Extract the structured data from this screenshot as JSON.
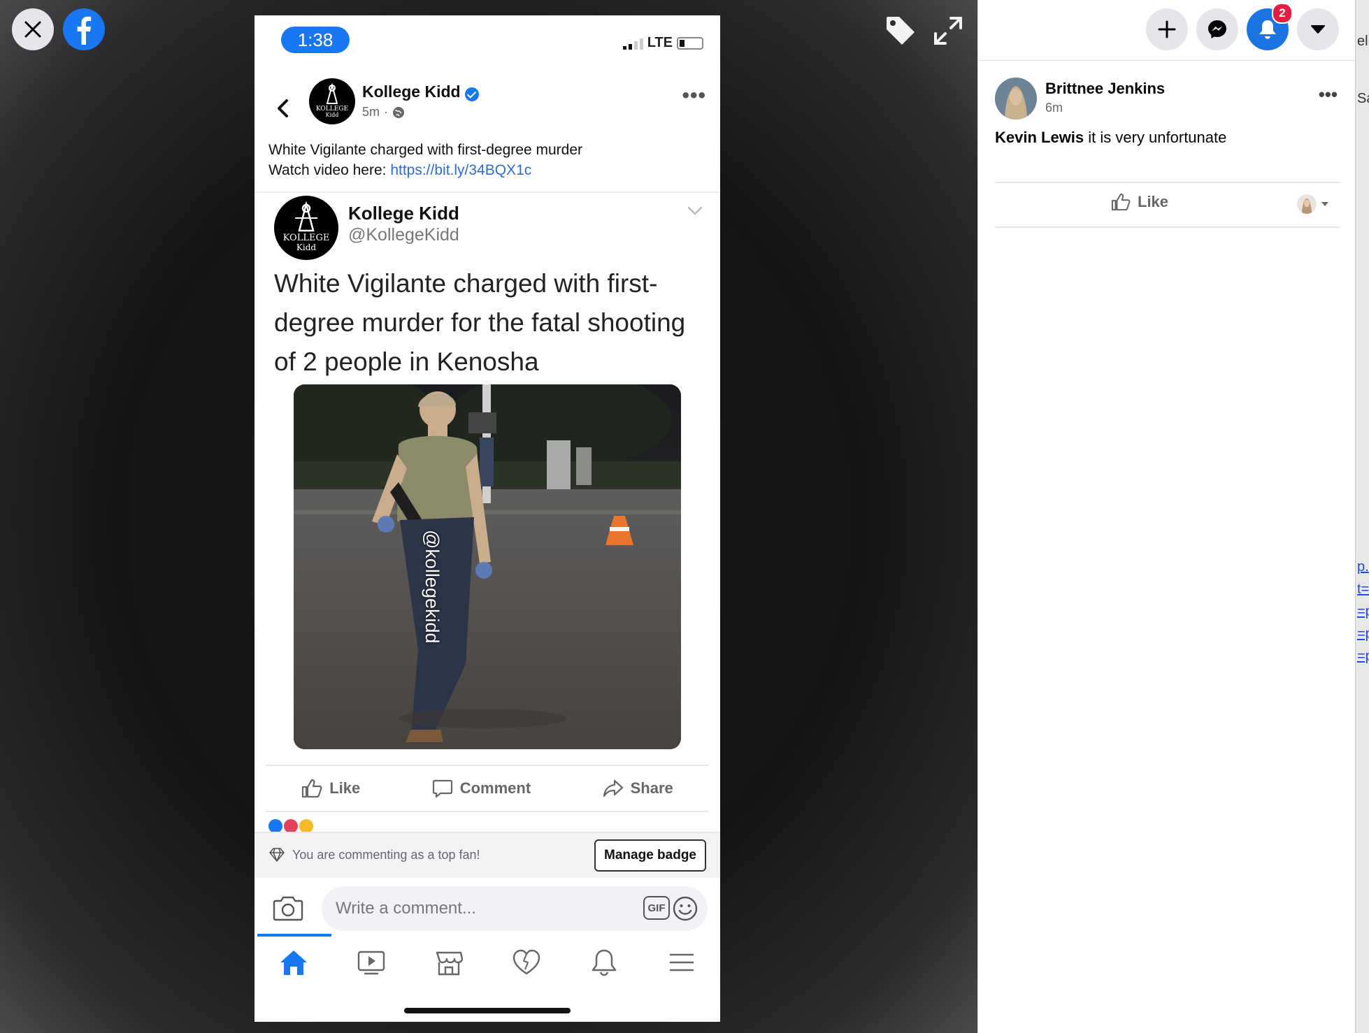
{
  "viewer": {
    "close_icon": "close-icon",
    "logo": "facebook-logo",
    "tag_icon": "tag-icon",
    "fullscreen_icon": "fullscreen-icon"
  },
  "phone": {
    "status": {
      "time": "1:38",
      "network": "LTE"
    },
    "post": {
      "author": "Kollege Kidd",
      "time": "5m",
      "separator": "·",
      "caption_line1": "White Vigilante charged with first-degree murder",
      "caption_prefix": "Watch video here: ",
      "caption_link": "https://bit.ly/34BQX1c"
    },
    "tweet": {
      "name": "Kollege Kidd",
      "handle": "@KollegeKidd",
      "text": "White Vigilante charged with first-degree murder for the fatal shooting of 2 people in Kenosha",
      "watermark": "@kollegekidd"
    },
    "actions": {
      "like": "Like",
      "comment": "Comment",
      "share": "Share"
    },
    "top_fan": {
      "text": "You are commenting as a top fan!",
      "button": "Manage badge"
    },
    "comment": {
      "placeholder": "Write a comment...",
      "gif": "GIF"
    }
  },
  "right_panel": {
    "notifications_count": "2",
    "comment": {
      "author": "Brittnee Jenkins",
      "time": "6m",
      "mention": "Kevin Lewis",
      "text": " it is very unfortunate",
      "like_label": "Like"
    }
  },
  "edge_strip": {
    "texts": [
      "ell",
      "Sa"
    ],
    "links": [
      "p.",
      "t=",
      "=p",
      "=p",
      "=p"
    ]
  },
  "colors": {
    "facebook_blue": "#1877f2",
    "notification_red": "#e41e3f",
    "link_blue": "#2f6bcf"
  }
}
